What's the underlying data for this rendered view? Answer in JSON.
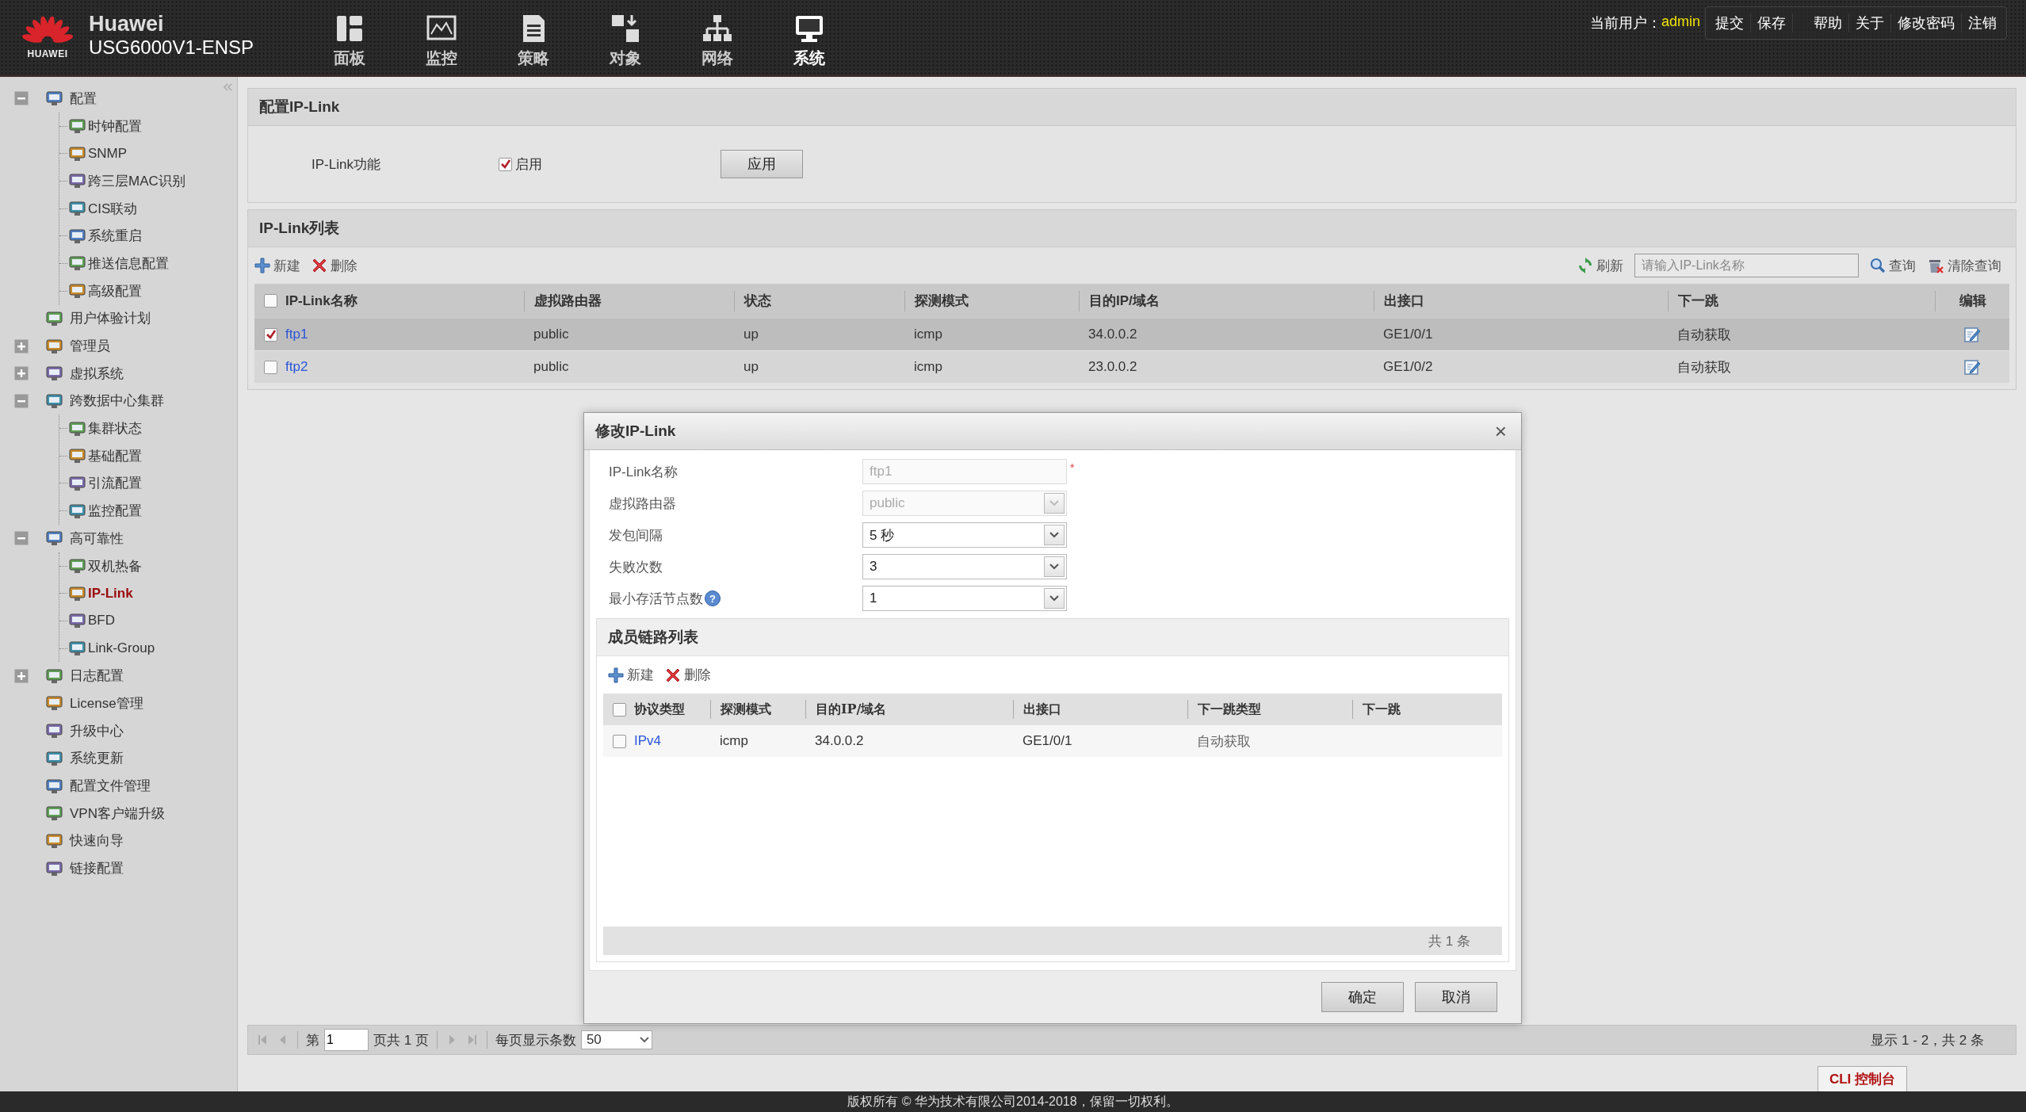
{
  "header": {
    "logo_text": "HUAWEI",
    "brand": "Huawei",
    "model": "USG6000V1-ENSP",
    "nav": [
      {
        "label": "面板",
        "kind": "dashboard",
        "selected": false
      },
      {
        "label": "监控",
        "kind": "monitor",
        "selected": false
      },
      {
        "label": "策略",
        "kind": "policy",
        "selected": false
      },
      {
        "label": "对象",
        "kind": "object",
        "selected": false
      },
      {
        "label": "网络",
        "kind": "network",
        "selected": false
      },
      {
        "label": "系统",
        "kind": "system",
        "selected": true
      }
    ],
    "user_label": "当前用户：",
    "user": "admin",
    "links": [
      "提交",
      "保存",
      "帮助",
      "关于",
      "修改密码",
      "注销"
    ]
  },
  "sidebar": {
    "items": [
      {
        "label": "配置",
        "expanded": true,
        "selected": false,
        "children": [
          {
            "label": "时钟配置",
            "selected": false
          },
          {
            "label": "SNMP",
            "selected": false
          },
          {
            "label": "跨三层MAC识别",
            "selected": false
          },
          {
            "label": "CIS联动",
            "selected": false
          },
          {
            "label": "系统重启",
            "selected": false
          },
          {
            "label": "推送信息配置",
            "selected": false
          },
          {
            "label": "高级配置",
            "selected": false
          }
        ]
      },
      {
        "label": "用户体验计划",
        "selected": false
      },
      {
        "label": "管理员",
        "expanded": false,
        "selected": false
      },
      {
        "label": "虚拟系统",
        "expanded": false,
        "selected": false
      },
      {
        "label": "跨数据中心集群",
        "expanded": true,
        "selected": false,
        "children": [
          {
            "label": "集群状态",
            "selected": false
          },
          {
            "label": "基础配置",
            "selected": false
          },
          {
            "label": "引流配置",
            "selected": false
          },
          {
            "label": "监控配置",
            "selected": false
          }
        ]
      },
      {
        "label": "高可靠性",
        "expanded": true,
        "selected": false,
        "children": [
          {
            "label": "双机热备",
            "selected": false
          },
          {
            "label": "IP-Link",
            "selected": true
          },
          {
            "label": "BFD",
            "selected": false
          },
          {
            "label": "Link-Group",
            "selected": false
          }
        ]
      },
      {
        "label": "日志配置",
        "expanded": false,
        "selected": false
      },
      {
        "label": "License管理",
        "selected": false
      },
      {
        "label": "升级中心",
        "selected": false
      },
      {
        "label": "系统更新",
        "selected": false
      },
      {
        "label": "配置文件管理",
        "selected": false
      },
      {
        "label": "VPN客户端升级",
        "selected": false
      },
      {
        "label": "快速向导",
        "selected": false
      },
      {
        "label": "链接配置",
        "selected": false
      }
    ]
  },
  "config_panel": {
    "title": "配置IP-Link",
    "field_label": "IP-Link功能",
    "enable_label": "启用",
    "enabled": true,
    "apply_button": "应用"
  },
  "list_panel": {
    "title": "IP-Link列表",
    "toolbar": [
      {
        "label": "新建",
        "kind": "add"
      },
      {
        "label": "删除",
        "kind": "delete"
      }
    ],
    "refresh": "刷新",
    "search": {
      "placeholder": "请输入IP-Link名称"
    },
    "query": "查询",
    "clear_query": "清除查询",
    "table": {
      "select_all_checked": false,
      "columns": [
        "IP-Link名称",
        "虚拟路由器",
        "状态",
        "探测模式",
        "目的IP/域名",
        "出接口",
        "下一跳",
        "编辑"
      ],
      "rows": [
        {
          "checked": true,
          "selected": true,
          "cells": [
            "ftp1",
            "public",
            "up",
            "icmp",
            "34.0.0.2",
            "GE1/0/1",
            "自动获取"
          ]
        },
        {
          "checked": false,
          "selected": false,
          "cells": [
            "ftp2",
            "public",
            "up",
            "icmp",
            "23.0.0.2",
            "GE1/0/2",
            "自动获取"
          ]
        }
      ]
    },
    "pager": {
      "page_prefix": "第",
      "page": "1",
      "page_suffix": "页共 1 页",
      "per_page_label": "每页显示条数",
      "per_page": "50",
      "summary": "显示 1 - 2，共 2 条"
    }
  },
  "cli_tab": "CLI 控制台",
  "footer": "版权所有 © 华为技术有限公司2014-2018，保留一切权利。",
  "dialog": {
    "title": "修改IP-Link",
    "close": "×",
    "fields": [
      {
        "label": "IP-Link名称",
        "kind": "text",
        "value": "ftp1",
        "disabled": true,
        "required_mark": "*"
      },
      {
        "label": "虚拟路由器",
        "kind": "select",
        "value": "public",
        "disabled": true
      },
      {
        "label": "发包间隔",
        "kind": "select",
        "value": "5 秒",
        "disabled": false
      },
      {
        "label": "失败次数",
        "kind": "select",
        "value": "3",
        "disabled": false
      },
      {
        "label": "最小存活节点数",
        "kind": "select",
        "value": "1",
        "disabled": false,
        "help": "?"
      }
    ],
    "members": {
      "title": "成员链路列表",
      "toolbar": [
        {
          "label": "新建",
          "kind": "add"
        },
        {
          "label": "删除",
          "kind": "delete"
        }
      ],
      "select_all_checked": false,
      "columns": [
        "协议类型",
        "探测模式",
        "目的IP/域名",
        "出接口",
        "下一跳类型",
        "下一跳"
      ],
      "rows": [
        {
          "checked": false,
          "cells": [
            "IPv4",
            "icmp",
            "34.0.0.2",
            "GE1/0/1",
            "自动获取"
          ]
        }
      ],
      "total": "共 1 条"
    },
    "buttons": [
      "确定",
      "取消"
    ]
  }
}
